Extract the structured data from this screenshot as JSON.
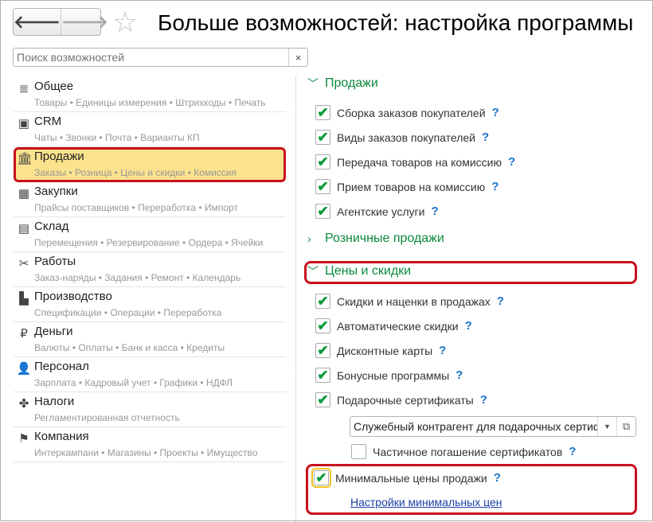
{
  "header": {
    "title": "Больше возможностей: настройка программы",
    "back": "back-arrow",
    "forward": "forward-arrow"
  },
  "search": {
    "placeholder": "Поиск возможностей",
    "clear": "×"
  },
  "sidebar": {
    "items": [
      {
        "icon": "≣",
        "label": "Общее",
        "sub": "Товары • Единицы измерения • Штрихкоды • Печать"
      },
      {
        "icon": "▣",
        "label": "CRM",
        "sub": "Чаты • Звонки • Почта • Варианты КП"
      },
      {
        "icon": "🏛",
        "label": "Продажи",
        "sub": "Заказы • Розница • Цены и скидки • Комиссия"
      },
      {
        "icon": "▦",
        "label": "Закупки",
        "sub": "Прайсы поставщиков • Переработка • Импорт"
      },
      {
        "icon": "▤",
        "label": "Склад",
        "sub": "Перемещения • Резервирование • Ордера • Ячейки"
      },
      {
        "icon": "✂",
        "label": "Работы",
        "sub": "Заказ-наряды • Задания • Ремонт • Календарь"
      },
      {
        "icon": "▙",
        "label": "Производство",
        "sub": "Спецификации • Операции • Переработка"
      },
      {
        "icon": "₽",
        "label": "Деньги",
        "sub": "Валюты • Оплаты • Банк и касса • Кредиты"
      },
      {
        "icon": "👤",
        "label": "Персонал",
        "sub": "Зарплата • Кадровый учет • Графики • НДФЛ"
      },
      {
        "icon": "✤",
        "label": "Налоги",
        "sub": "Регламентированная отчетность"
      },
      {
        "icon": "⚑",
        "label": "Компания",
        "sub": "Интеркампани • Магазины • Проекты • Имущество"
      }
    ]
  },
  "main": {
    "sales": {
      "title": "Продажи",
      "items": [
        "Сборка заказов покупателей",
        "Виды заказов покупателей",
        "Передача товаров на комиссию",
        "Прием товаров на комиссию",
        "Агентские услуги"
      ]
    },
    "retail": {
      "title": "Розничные продажи"
    },
    "prices": {
      "title": "Цены и скидки",
      "items": [
        "Скидки и наценки в продажах",
        "Автоматические скидки",
        "Дисконтные карты",
        "Бонусные программы",
        "Подарочные сертификаты"
      ],
      "combo_value": "Служебный контрагент для подарочных сертификатов",
      "partial": "Частичное погашение сертификатов",
      "min_prices": "Минимальные цены продажи",
      "min_link": "Настройки минимальных цен"
    },
    "help": "?",
    "check": "✔"
  }
}
